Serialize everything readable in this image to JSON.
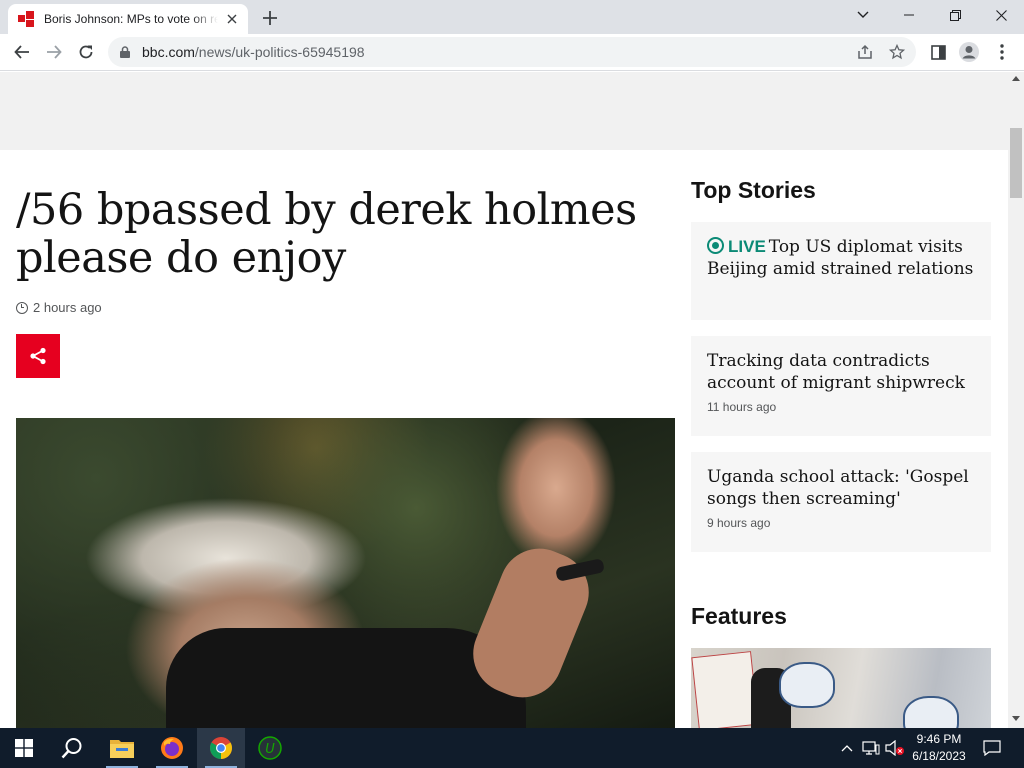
{
  "browser": {
    "tab_title": "Boris Johnson: MPs to vote on report",
    "url_domain": "bbc.com",
    "url_path": "/news/uk-politics-65945198"
  },
  "article": {
    "headline": "/56 bpassed by derek holmes please do enjoy",
    "timestamp": "2 hours ago",
    "share_icon": "share-icon",
    "hero_image_alt": "Boris Johnson waving"
  },
  "sidebar": {
    "top_stories_title": "Top Stories",
    "stories": [
      {
        "live": true,
        "live_label": "LIVE",
        "title": "Top US diplomat visits Beijing amid strained relations",
        "time": ""
      },
      {
        "live": false,
        "title": "Tracking data contradicts account of migrant shipwreck",
        "time": "11 hours ago"
      },
      {
        "live": false,
        "title": "Uganda school attack: 'Gospel songs then screaming'",
        "time": "9 hours ago"
      }
    ],
    "features_title": "Features"
  },
  "taskbar": {
    "time": "9:46 PM",
    "date": "6/18/2023",
    "apps": [
      "start-icon",
      "search-icon",
      "file-explorer-icon",
      "firefox-icon",
      "chrome-icon",
      "upwork-icon"
    ]
  },
  "colors": {
    "bbc_red": "#e6001f",
    "live_green": "#0b8a76",
    "taskbar_bg": "#101c2b"
  }
}
